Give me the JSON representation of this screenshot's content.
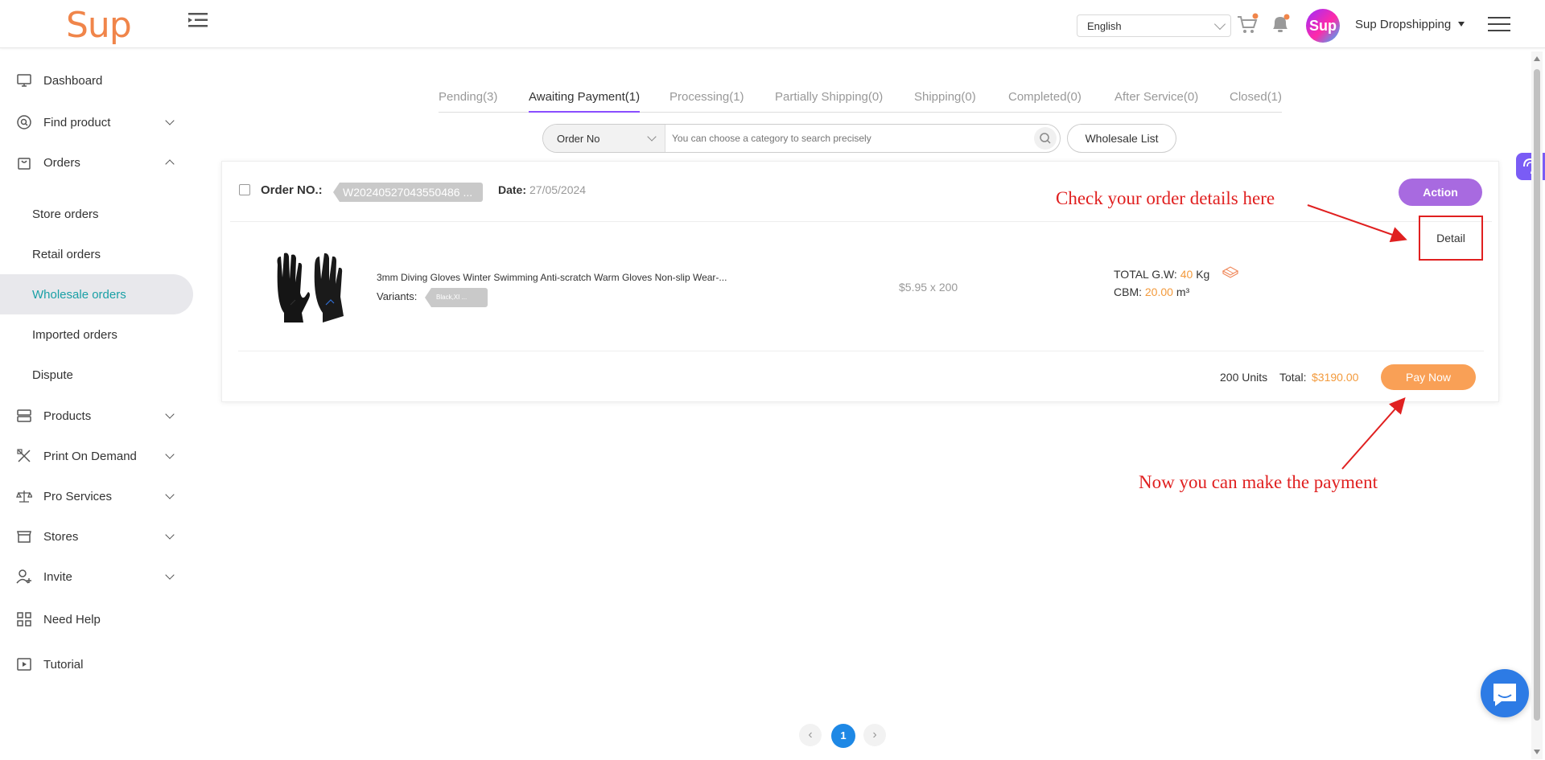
{
  "header": {
    "logo": "Sup",
    "language": "English",
    "avatar_text": "Sup",
    "user_name": "Sup Dropshipping"
  },
  "sidebar": {
    "items": [
      {
        "label": "Dashboard"
      },
      {
        "label": "Find product"
      },
      {
        "label": "Orders"
      },
      {
        "label": "Products"
      },
      {
        "label": "Print On Demand"
      },
      {
        "label": "Pro Services"
      },
      {
        "label": "Stores"
      },
      {
        "label": "Invite"
      },
      {
        "label": "Need Help"
      },
      {
        "label": "Tutorial"
      }
    ],
    "orders_sub": [
      {
        "label": "Store orders"
      },
      {
        "label": "Retail orders"
      },
      {
        "label": "Wholesale orders"
      },
      {
        "label": "Imported orders"
      },
      {
        "label": "Dispute"
      }
    ]
  },
  "tabs": [
    {
      "label": "Pending(3)"
    },
    {
      "label": "Awaiting Payment(1)"
    },
    {
      "label": "Processing(1)"
    },
    {
      "label": "Partially Shipping(0)"
    },
    {
      "label": "Shipping(0)"
    },
    {
      "label": "Completed(0)"
    },
    {
      "label": "After Service(0)"
    },
    {
      "label": "Closed(1)"
    }
  ],
  "search": {
    "category": "Order No",
    "placeholder": "You can choose a category to search precisely",
    "wholesale_list": "Wholesale List"
  },
  "order": {
    "order_no_label": "Order NO.:",
    "order_no": "W20240527043550486 ...",
    "date_label": "Date:",
    "date": "27/05/2024",
    "action_label": "Action",
    "detail_label": "Detail",
    "product_title": "3mm Diving Gloves Winter Swimming Anti-scratch Warm Gloves Non-slip Wear-...",
    "variants_label": "Variants:",
    "variant": "Black,XI ...",
    "price_qty": "$5.95 x 200",
    "gw_label": "TOTAL G.W:",
    "gw_value": "40",
    "gw_unit": "Kg",
    "cbm_label": "CBM:",
    "cbm_value": "20.00",
    "cbm_unit": "m³",
    "units": "200 Units",
    "total_label": "Total:",
    "total_value": "$3190.00",
    "pay_label": "Pay Now"
  },
  "annotations": {
    "detail_note": "Check your order details here",
    "pay_note": "Now you can make the payment"
  },
  "pagination": {
    "prev": "‹",
    "current": "1",
    "next": "›"
  },
  "colors": {
    "brand_orange": "#f0854a",
    "tab_accent": "#8a4dff",
    "action_purple": "#a86ae0",
    "pay_orange": "#f9a056",
    "active_teal": "#1aa0a6",
    "annotation_red": "#e02020",
    "page_blue": "#1e88e5"
  }
}
